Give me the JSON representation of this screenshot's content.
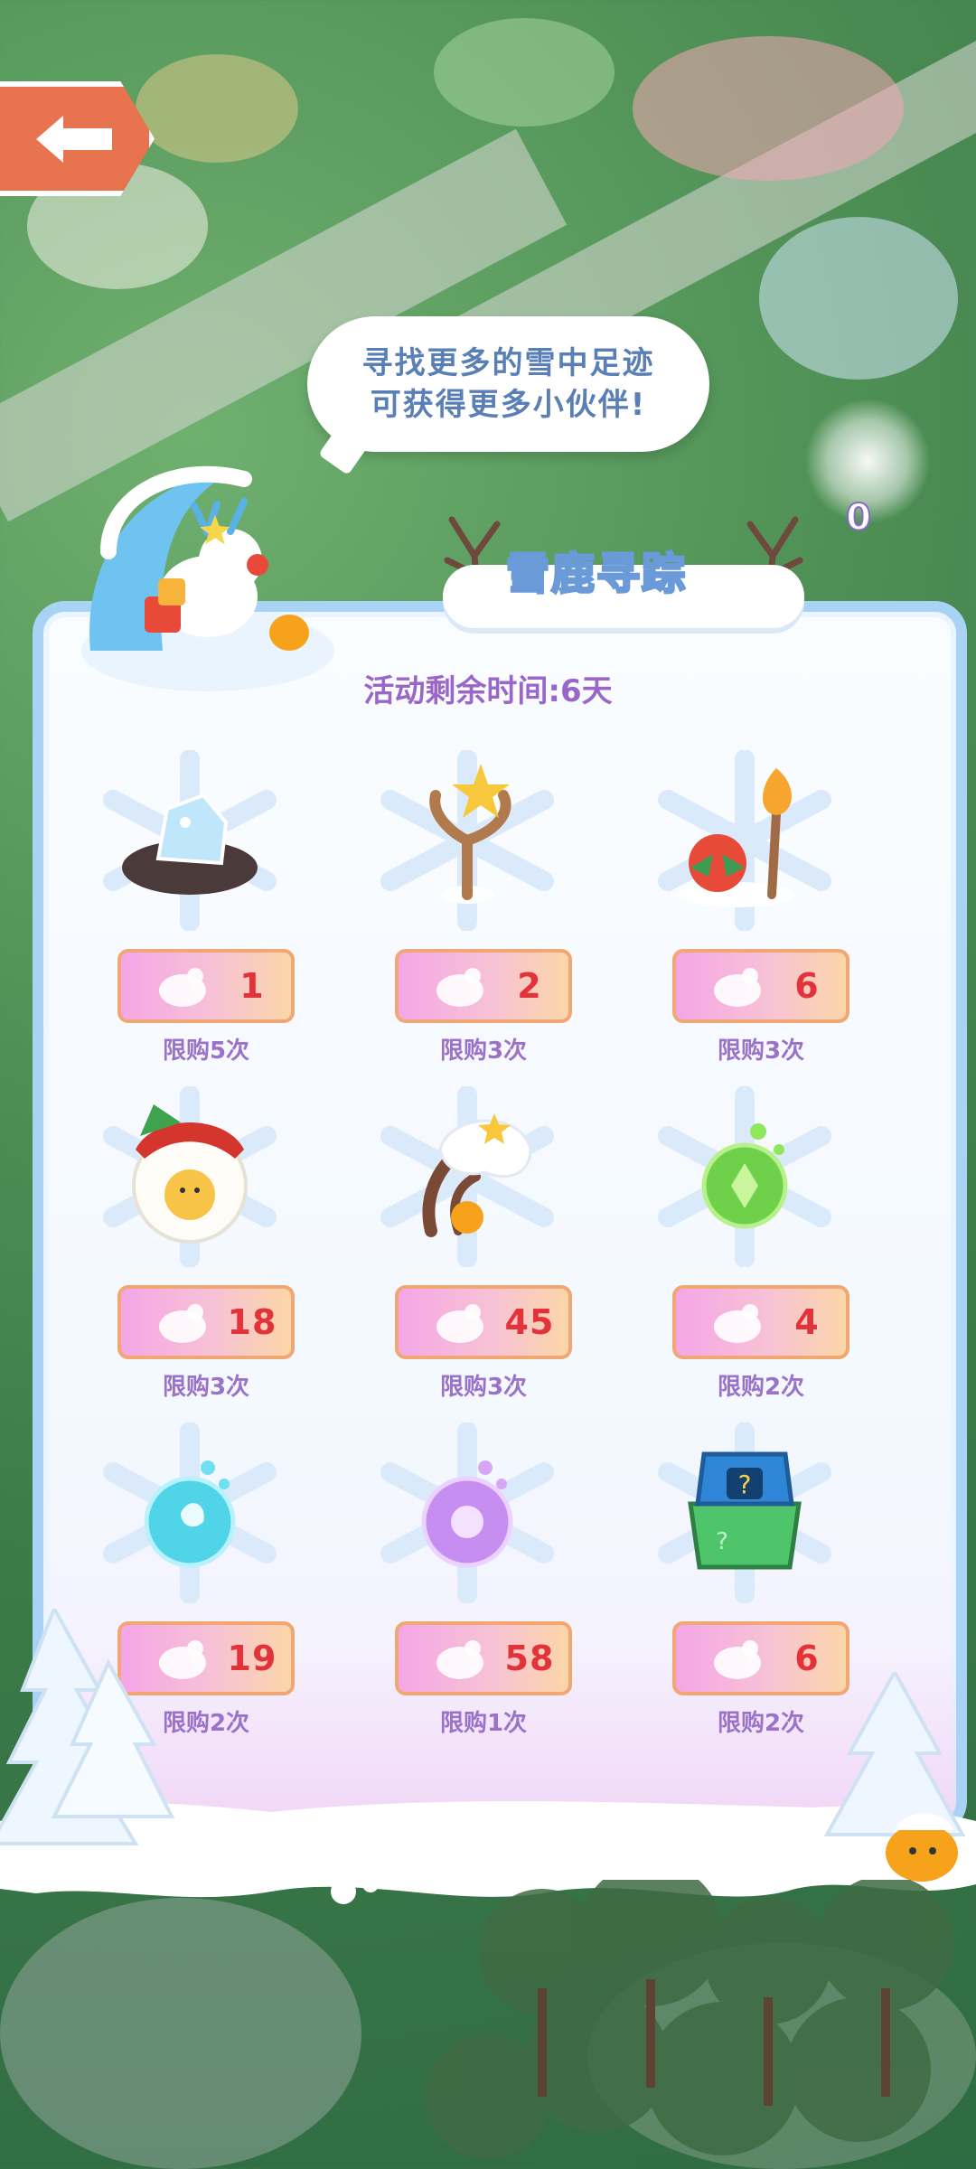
{
  "hint": {
    "line1": "寻找更多的雪中足迹",
    "line2": "可获得更多小伙伴!"
  },
  "title": "雪鹿寻踪",
  "snow_count": "0",
  "timer": "活动剩余时间:6天",
  "items": [
    {
      "art": "snow-rock-icon",
      "price": "1",
      "limit": "限购5次"
    },
    {
      "art": "star-branch-icon",
      "price": "2",
      "limit": "限购3次"
    },
    {
      "art": "lantern-torch-icon",
      "price": "6",
      "limit": "限购3次"
    },
    {
      "art": "chick-egg-house-icon",
      "price": "18",
      "limit": "限购3次"
    },
    {
      "art": "antler-snow-icon",
      "price": "45",
      "limit": "限购3次"
    },
    {
      "art": "green-orb-icon",
      "price": "4",
      "limit": "限购2次"
    },
    {
      "art": "blue-orb-icon",
      "price": "19",
      "limit": "限购2次"
    },
    {
      "art": "purple-orb-icon",
      "price": "58",
      "limit": "限购1次"
    },
    {
      "art": "mystery-bag-icon",
      "price": "6",
      "limit": "限购2次"
    }
  ],
  "colors": {
    "panel_border": "#a9d3f5",
    "price_text": "#e2333a",
    "limit_text": "#9a72c8",
    "title_stroke": "#6b9ad8"
  }
}
